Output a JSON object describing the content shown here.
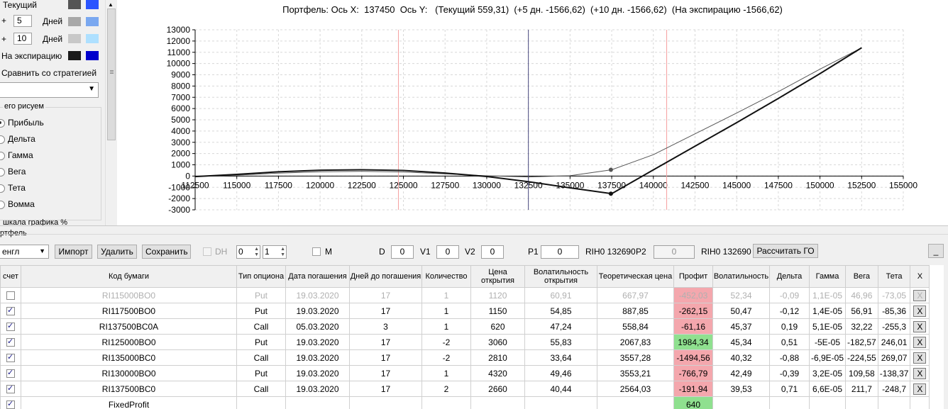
{
  "left_panel": {
    "rows": [
      {
        "label": "Текущий",
        "c1": "#555555",
        "c2": "#2b55ff"
      },
      {
        "prefix": "+",
        "value": "5",
        "unit": "Дней",
        "c1": "#a8a8a8",
        "c2": "#7aa8f0"
      },
      {
        "prefix": "+",
        "value": "10",
        "unit": "Дней",
        "c1": "#c8c8c8",
        "c2": "#aee0ff"
      },
      {
        "label": "На экспирацию",
        "c1": "#1a1a1a",
        "c2": "#0000cc"
      }
    ],
    "compare_label": "Сравнить со стратегией",
    "group_title": "его рисуем",
    "radios": [
      "Прибыль",
      "Дельта",
      "Гамма",
      "Вега",
      "Тета",
      "Вомма"
    ],
    "selected_radio": "Прибыль",
    "bottom_cut": "шкала графика %"
  },
  "chart": {
    "header": "Портфель: Ось X:  137450  Ось Y:   (Текущий 559,31)  (+5 дн. -1566,62)  (+10 дн. -1566,62)  (На экспирацию -1566,62)"
  },
  "chart_data": {
    "type": "line",
    "xlim": [
      112500,
      155000
    ],
    "ylim": [
      -3000,
      13000
    ],
    "x_ticks": [
      112500,
      115000,
      117500,
      120000,
      122500,
      125000,
      127500,
      130000,
      132500,
      135000,
      137500,
      140000,
      142500,
      145000,
      147500,
      150000,
      152500,
      155000
    ],
    "y_ticks": [
      -3000,
      -2000,
      -1000,
      0,
      1000,
      2000,
      3000,
      4000,
      5000,
      6000,
      7000,
      8000,
      9000,
      10000,
      11000,
      12000,
      13000
    ],
    "grid": true,
    "vlines": [
      {
        "x": 124700,
        "color": "#f5a0a0"
      },
      {
        "x": 132500,
        "color": "#4a4a80"
      },
      {
        "x": 140800,
        "color": "#f5a0a0"
      }
    ],
    "series": [
      {
        "color": "#555555",
        "width": 1,
        "x": [
          112500,
          115000,
          117500,
          120000,
          122500,
          125000,
          127500,
          130000,
          132500,
          135000,
          137500,
          140000,
          142500,
          145000,
          147500,
          150000,
          152500
        ],
        "y": [
          -50,
          80,
          260,
          380,
          420,
          360,
          200,
          20,
          -80,
          30,
          560,
          1900,
          3750,
          5600,
          7500,
          9500,
          11400
        ]
      },
      {
        "color": "#111111",
        "width": 2,
        "x": [
          112500,
          115000,
          117500,
          120000,
          122500,
          125000,
          127500,
          130000,
          132500,
          135000,
          137500,
          140000,
          142500,
          145000,
          147500,
          150000,
          152500
        ],
        "y": [
          -50,
          150,
          380,
          520,
          560,
          500,
          270,
          -40,
          -500,
          -1050,
          -1566.62,
          550,
          2650,
          4750,
          6900,
          9100,
          11400
        ]
      }
    ],
    "markers": [
      {
        "x": 137450,
        "y": 559.31,
        "color": "#555555"
      },
      {
        "x": 137450,
        "y": -1566.62,
        "color": "#111111"
      }
    ]
  },
  "portfolio": {
    "title": "ртфель",
    "combo": "енгл",
    "btn_import": "Импорт",
    "btn_delete": "Удалить",
    "btn_save": "Сохранить",
    "dh_label": "DH",
    "spin1": "0",
    "spin2": "1",
    "m_label": "M",
    "d_label": "D",
    "d_val": "0",
    "v1_label": "V1",
    "v1_val": "0",
    "v2_label": "V2",
    "v2_val": "0",
    "p1_label": "P1",
    "p1_val": "0",
    "rih1": "RIH0 132690",
    "p2_label": "P2",
    "p2_val": "0",
    "rih2": "RIH0 132690",
    "btn_go": "Рассчитать ГО",
    "btn_min": "_"
  },
  "table": {
    "headers": [
      "счет",
      "Код бумаги",
      "Тип опциона",
      "Дата погашения",
      "Дней до погашения",
      "Количество",
      "Цена открытия",
      "Волатильность открытия",
      "Теоретическая цена",
      "Профит",
      "Волатильность",
      "Дельта",
      "Гамма",
      "Вега",
      "Тета",
      "X"
    ],
    "rows": [
      {
        "checked": false,
        "dim": true,
        "cells": [
          "RI115000BO0",
          "Put",
          "19.03.2020",
          "17",
          "1",
          "1120",
          "60,91",
          "667,97",
          "-452,03",
          "52,34",
          "-0,09",
          "1,1E-05",
          "46,96",
          "-73,05"
        ],
        "profit": "red"
      },
      {
        "checked": true,
        "dim": false,
        "cells": [
          "RI117500BO0",
          "Put",
          "19.03.2020",
          "17",
          "1",
          "1150",
          "54,85",
          "887,85",
          "-262,15",
          "50,47",
          "-0,12",
          "1,4E-05",
          "56,91",
          "-85,36"
        ],
        "profit": "red"
      },
      {
        "checked": true,
        "dim": false,
        "cells": [
          "RI137500BC0A",
          "Call",
          "05.03.2020",
          "3",
          "1",
          "620",
          "47,24",
          "558,84",
          "-61,16",
          "45,37",
          "0,19",
          "5,1E-05",
          "32,22",
          "-255,3"
        ],
        "profit": "red"
      },
      {
        "checked": true,
        "dim": false,
        "cells": [
          "RI125000BO0",
          "Put",
          "19.03.2020",
          "17",
          "-2",
          "3060",
          "55,83",
          "2067,83",
          "1984,34",
          "45,34",
          "0,51",
          "-5E-05",
          "-182,57",
          "246,01"
        ],
        "profit": "green"
      },
      {
        "checked": true,
        "dim": false,
        "cells": [
          "RI135000BC0",
          "Call",
          "19.03.2020",
          "17",
          "-2",
          "2810",
          "33,64",
          "3557,28",
          "-1494,56",
          "40,32",
          "-0,88",
          "-6,9E-05",
          "-224,55",
          "269,07"
        ],
        "profit": "red"
      },
      {
        "checked": true,
        "dim": false,
        "cells": [
          "RI130000BO0",
          "Put",
          "19.03.2020",
          "17",
          "1",
          "4320",
          "49,46",
          "3553,21",
          "-766,79",
          "42,49",
          "-0,39",
          "3,2E-05",
          "109,58",
          "-138,37"
        ],
        "profit": "red"
      },
      {
        "checked": true,
        "dim": false,
        "cells": [
          "RI137500BC0",
          "Call",
          "19.03.2020",
          "17",
          "2",
          "2660",
          "40,44",
          "2564,03",
          "-191,94",
          "39,53",
          "0,71",
          "6,6E-05",
          "211,7",
          "-248,7"
        ],
        "profit": "red"
      },
      {
        "checked": true,
        "dim": false,
        "cells": [
          "FixedProfit",
          "",
          "",
          "",
          "",
          "",
          "",
          "",
          "640",
          "",
          "",
          "",
          "",
          ""
        ],
        "profit": "green"
      }
    ],
    "x_label": "X"
  }
}
